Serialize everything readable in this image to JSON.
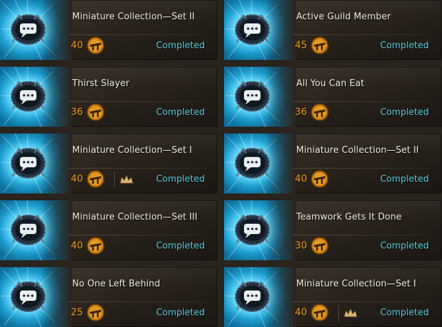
{
  "colors": {
    "points": "#f0a21e",
    "status": "#53cfe0",
    "title": "#f1ede6",
    "glow": "#5fd2f6"
  },
  "icons": {
    "achievement": "speech-bubble-achievement-icon",
    "points": "achievement-points-icon",
    "reward": "crown-icon"
  },
  "achievements": [
    {
      "title": "Miniature Collection—Set II",
      "points": "40",
      "status": "Completed",
      "has_reward": false
    },
    {
      "title": "Active Guild Member",
      "points": "45",
      "status": "Completed",
      "has_reward": false
    },
    {
      "title": "Thirst Slayer",
      "points": "36",
      "status": "Completed",
      "has_reward": false
    },
    {
      "title": "All You Can Eat",
      "points": "36",
      "status": "Completed",
      "has_reward": false
    },
    {
      "title": "Miniature Collection—Set I",
      "points": "40",
      "status": "Completed",
      "has_reward": true
    },
    {
      "title": "Miniature Collection—Set II",
      "points": "40",
      "status": "Completed",
      "has_reward": false
    },
    {
      "title": "Miniature Collection—Set III",
      "points": "40",
      "status": "Completed",
      "has_reward": false
    },
    {
      "title": "Teamwork Gets It Done",
      "points": "30",
      "status": "Completed",
      "has_reward": false
    },
    {
      "title": "No One Left Behind",
      "points": "25",
      "status": "Completed",
      "has_reward": false
    },
    {
      "title": "Miniature Collection—Set I",
      "points": "40",
      "status": "Completed",
      "has_reward": true
    }
  ]
}
